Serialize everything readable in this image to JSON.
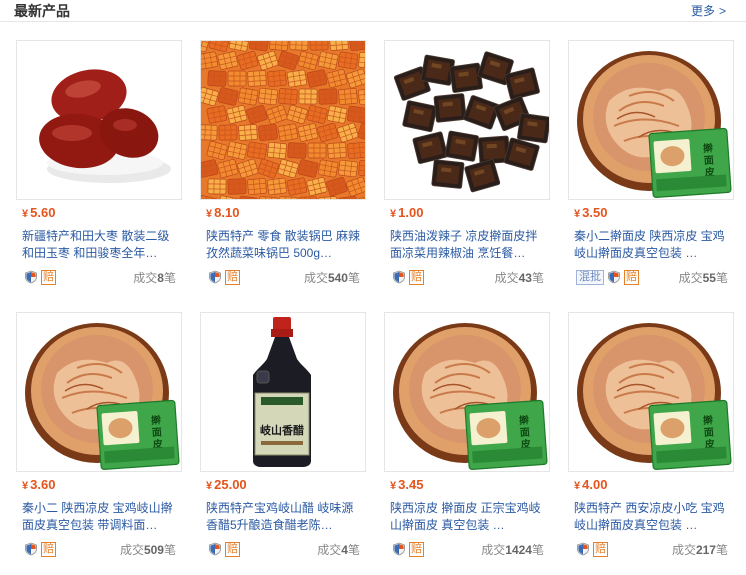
{
  "header": {
    "title": "最新产品",
    "more_label": "更多",
    "more_chevron": ">"
  },
  "currency": "¥",
  "sales_prefix": "成交",
  "sales_suffix": "笔",
  "badge_pei": "赔",
  "badge_hunpi": "混批",
  "colors": {
    "price": "#e4541c",
    "link": "#2b5aa3",
    "badge": "#e6802b"
  },
  "products": [
    {
      "price": "5.60",
      "name": "新疆特产和田大枣 散装二级和田玉枣 和田骏枣全年…",
      "sales": "8",
      "image": "red-dates",
      "hunpi": false
    },
    {
      "price": "8.10",
      "name": "陕西特产 零食 散装锅巴 麻辣孜然蔬菜味锅巴 500g…",
      "sales": "540",
      "image": "guoba-crackers",
      "hunpi": false
    },
    {
      "price": "1.00",
      "name": "陕西油泼辣子 凉皮擀面皮拌面凉菜用辣椒油 烹饪餐…",
      "sales": "43",
      "image": "chili-oil-packets",
      "hunpi": false
    },
    {
      "price": "3.50",
      "name": "秦小二擀面皮 陕西凉皮 宝鸡岐山擀面皮真空包装 …",
      "sales": "55",
      "image": "ganmianpi",
      "hunpi": true
    },
    {
      "price": "3.60",
      "name": "秦小二 陕西凉皮 宝鸡岐山擀面皮真空包装 带调料面…",
      "sales": "509",
      "image": "ganmianpi",
      "hunpi": false
    },
    {
      "price": "25.00",
      "name": "陕西特产宝鸡岐山醋 岐味源香醋5升酿造食醋老陈…",
      "sales": "4",
      "image": "vinegar-bottle",
      "hunpi": false,
      "bottle_label": "岐山香醋"
    },
    {
      "price": "3.45",
      "name": "陕西凉皮 擀面皮 正宗宝鸡岐山擀面皮 真空包装 …",
      "sales": "1424",
      "image": "ganmianpi",
      "hunpi": false
    },
    {
      "price": "4.00",
      "name": "陕西特产 西安凉皮小吃 宝鸡岐山擀面皮真空包装 …",
      "sales": "217",
      "image": "ganmianpi",
      "hunpi": false
    }
  ],
  "package_label": "擀面皮"
}
